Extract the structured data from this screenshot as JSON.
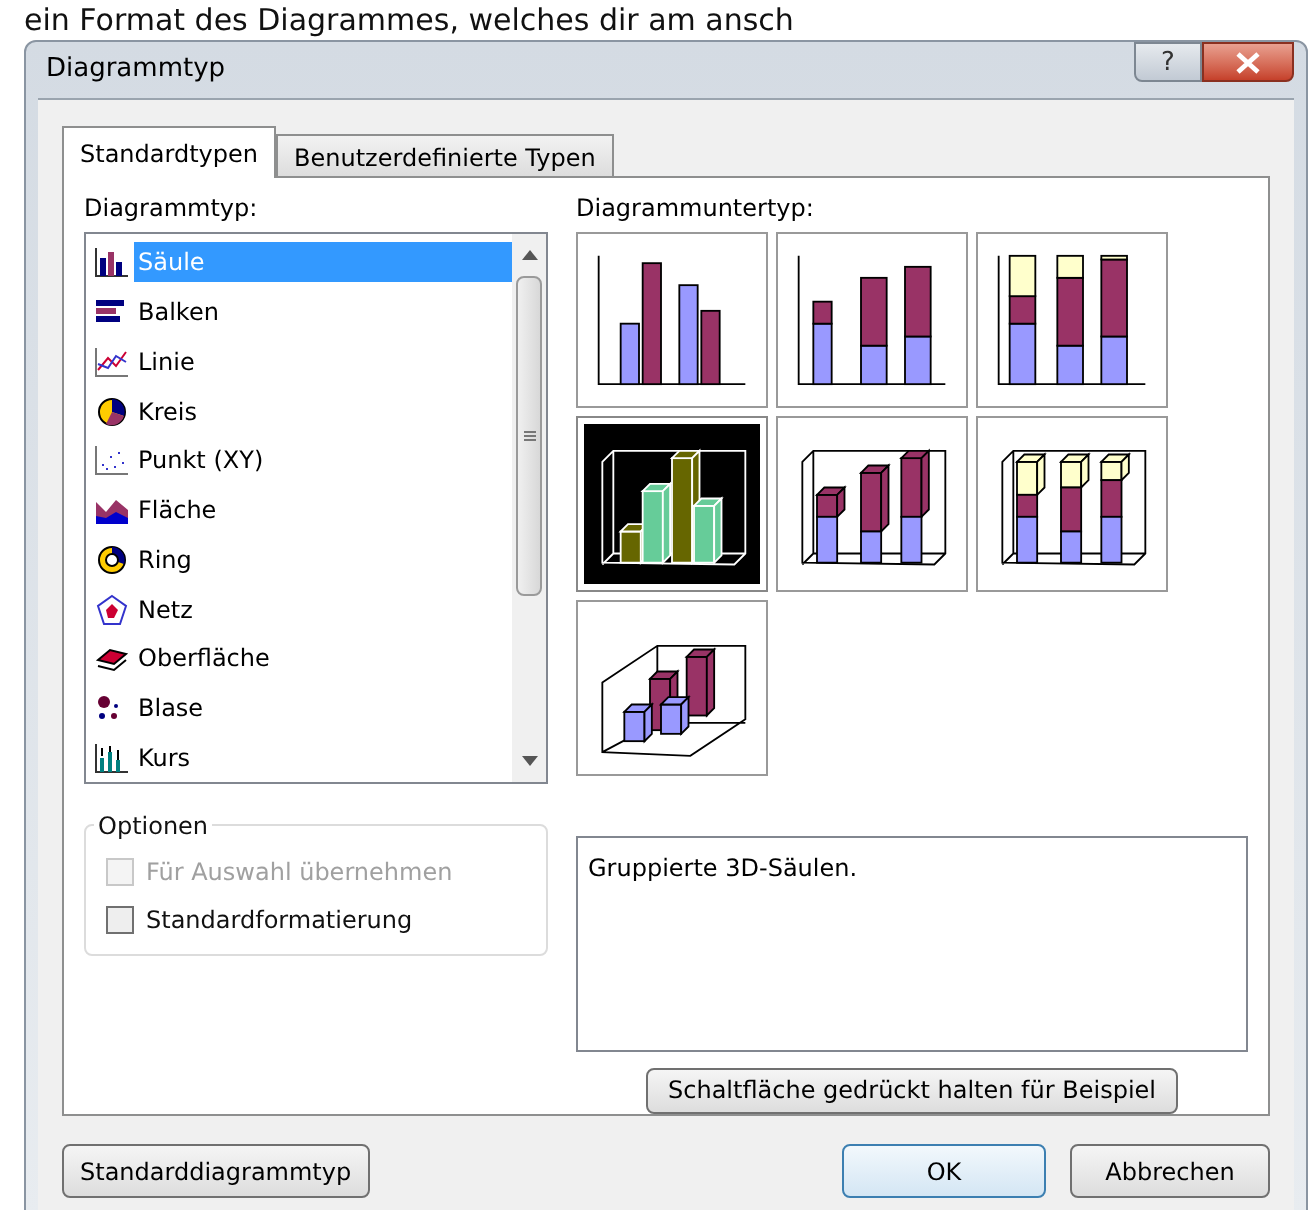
{
  "page_text": "ein Format des Diagrammes, welches dir am ansch",
  "window": {
    "title": "Diagrammtyp",
    "help": "?"
  },
  "tabs": [
    {
      "label": "Standardtypen",
      "selected": true
    },
    {
      "label": "Benutzerdefinierte Typen",
      "selected": false
    }
  ],
  "chart_types": {
    "label": "Diagrammtyp:",
    "items": [
      {
        "label": "Säule",
        "kind": "column",
        "selected": true
      },
      {
        "label": "Balken",
        "kind": "bar",
        "selected": false
      },
      {
        "label": "Linie",
        "kind": "line",
        "selected": false
      },
      {
        "label": "Kreis",
        "kind": "pie",
        "selected": false
      },
      {
        "label": "Punkt (XY)",
        "kind": "scatter",
        "selected": false
      },
      {
        "label": "Fläche",
        "kind": "area",
        "selected": false
      },
      {
        "label": "Ring",
        "kind": "ring",
        "selected": false
      },
      {
        "label": "Netz",
        "kind": "radar",
        "selected": false
      },
      {
        "label": "Oberfläche",
        "kind": "surface",
        "selected": false
      },
      {
        "label": "Blase",
        "kind": "bubble",
        "selected": false
      },
      {
        "label": "Kurs",
        "kind": "stock",
        "selected": false
      }
    ]
  },
  "options": {
    "label": "Optionen",
    "items": [
      {
        "label": "Für Auswahl übernehmen",
        "checked": false,
        "disabled": true
      },
      {
        "label": "Standardformatierung",
        "checked": false,
        "disabled": false
      }
    ]
  },
  "subtypes": {
    "label": "Diagrammuntertyp:",
    "items": [
      {
        "kind": "clustered",
        "selected": false
      },
      {
        "kind": "stacked",
        "selected": false
      },
      {
        "kind": "stacked100",
        "selected": false
      },
      {
        "kind": "clustered3d",
        "selected": true
      },
      {
        "kind": "stacked3d",
        "selected": false
      },
      {
        "kind": "stacked100_3d",
        "selected": false
      },
      {
        "kind": "column3d",
        "selected": false
      }
    ]
  },
  "description": "Gruppierte 3D-Säulen.",
  "preview_button": "Schaltfläche gedrückt halten für Beispiel",
  "footer": {
    "default_button": "Standarddiagrammtyp",
    "ok": "OK",
    "cancel": "Abbrechen"
  }
}
